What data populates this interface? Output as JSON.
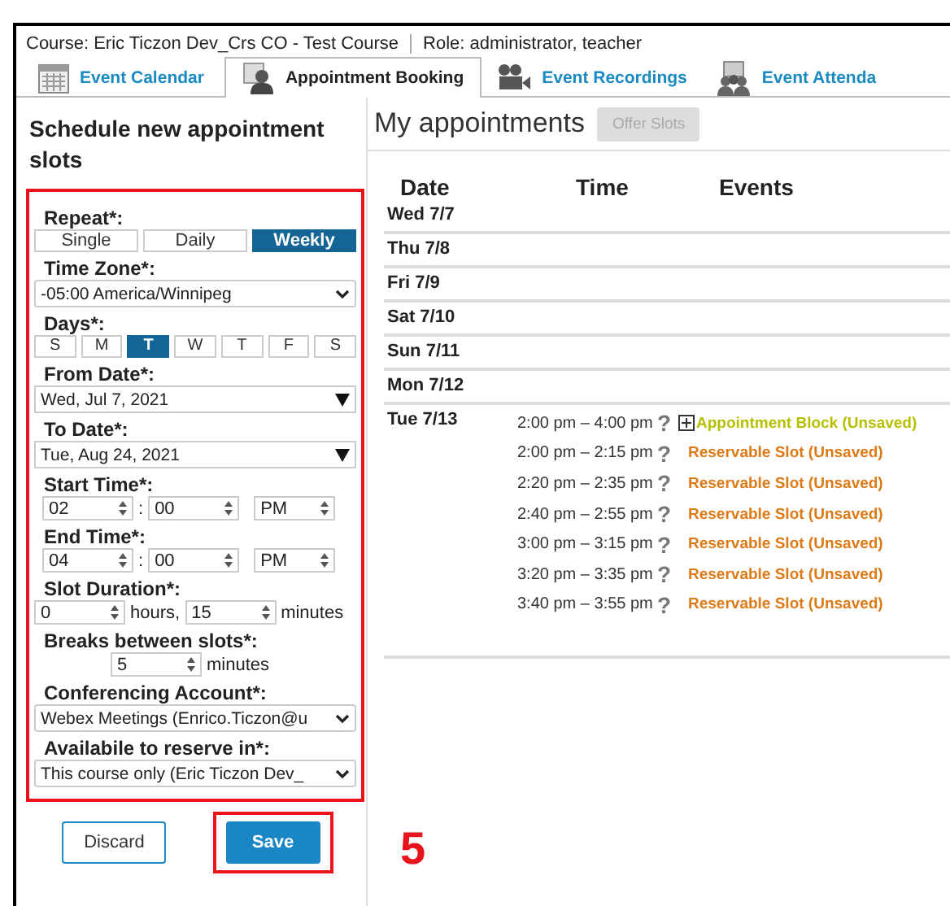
{
  "header": {
    "course": "Course: Eric Ticzon Dev_Crs CO - Test Course",
    "role": "Role: administrator, teacher"
  },
  "tabs": [
    {
      "label": "Event Calendar",
      "selected": false
    },
    {
      "label": "Appointment Booking",
      "selected": true
    },
    {
      "label": "Event Recordings",
      "selected": false
    },
    {
      "label": "Event Attenda",
      "selected": false
    }
  ],
  "form": {
    "title": "Schedule new appointment slots",
    "highlighted": true,
    "fields": [
      {
        "kind": "segmented",
        "label": "Repeat*:",
        "options": [
          {
            "label": "Single",
            "selected": false
          },
          {
            "label": "Daily",
            "selected": false
          },
          {
            "label": "Weekly",
            "selected": true
          }
        ]
      },
      {
        "kind": "select",
        "label": "Time Zone*:",
        "value": "-05:00 America/Winnipeg"
      },
      {
        "kind": "days",
        "label": "Days*:",
        "options": [
          {
            "label": "S",
            "selected": false
          },
          {
            "label": "M",
            "selected": false
          },
          {
            "label": "T",
            "selected": true
          },
          {
            "label": "W",
            "selected": false
          },
          {
            "label": "T",
            "selected": false
          },
          {
            "label": "F",
            "selected": false
          },
          {
            "label": "S",
            "selected": false
          }
        ]
      },
      {
        "kind": "date",
        "label": "From Date*:",
        "value": "Wed, Jul 7, 2021"
      },
      {
        "kind": "date",
        "label": "To Date*:",
        "value": "Tue, Aug 24, 2021"
      },
      {
        "kind": "time",
        "label": "Start Time*:",
        "hour": "02",
        "separator": ":",
        "minute": "00",
        "ampm": "PM"
      },
      {
        "kind": "time",
        "label": "End Time*:",
        "hour": "04",
        "separator": ":",
        "minute": "00",
        "ampm": "PM"
      },
      {
        "kind": "duration",
        "label": "Slot Duration*:",
        "hours": "0",
        "hours_unit": "hours,",
        "minutes": "15",
        "minutes_unit": "minutes"
      },
      {
        "kind": "breaks",
        "label": "Breaks between slots*:",
        "value": "5",
        "unit": "minutes"
      },
      {
        "kind": "select",
        "label": "Conferencing Account*:",
        "value": "Webex Meetings (Enrico.Ticzon@u"
      },
      {
        "kind": "select",
        "label": "Availabile to reserve in*:",
        "value": "This course only (Eric Ticzon Dev_"
      }
    ]
  },
  "buttons": [
    {
      "label": "Discard",
      "kind": "secondary",
      "highlighted": false
    },
    {
      "label": "Save",
      "kind": "primary",
      "highlighted": true
    }
  ],
  "step_number": "5",
  "appointments": {
    "title": "My appointments",
    "offer_button": {
      "label": "Offer Slots",
      "disabled": true
    },
    "columns": [
      "Date",
      "Time",
      "Events"
    ],
    "rows": [
      {
        "date": "Wed 7/7",
        "entries": []
      },
      {
        "date": "Thu 7/8",
        "entries": []
      },
      {
        "date": "Fri 7/9",
        "entries": []
      },
      {
        "date": "Sat 7/10",
        "entries": []
      },
      {
        "date": "Sun 7/11",
        "entries": []
      },
      {
        "date": "Mon 7/12",
        "entries": []
      },
      {
        "date": "Tue 7/13",
        "entries": [
          {
            "time": "2:00 pm – 4:00 pm",
            "help": "?",
            "kind": "block",
            "label": "Appointment Block (Unsaved)"
          },
          {
            "time": "2:00 pm – 2:15 pm",
            "help": "?",
            "kind": "slot",
            "label": "Reservable Slot (Unsaved)"
          },
          {
            "time": "2:20 pm – 2:35 pm",
            "help": "?",
            "kind": "slot",
            "label": "Reservable Slot (Unsaved)"
          },
          {
            "time": "2:40 pm – 2:55 pm",
            "help": "?",
            "kind": "slot",
            "label": "Reservable Slot (Unsaved)"
          },
          {
            "time": "3:00 pm – 3:15 pm",
            "help": "?",
            "kind": "slot",
            "label": "Reservable Slot (Unsaved)"
          },
          {
            "time": "3:20 pm – 3:35 pm",
            "help": "?",
            "kind": "slot",
            "label": "Reservable Slot (Unsaved)"
          },
          {
            "time": "3:40 pm – 3:55 pm",
            "help": "?",
            "kind": "slot",
            "label": "Reservable Slot (Unsaved)"
          }
        ]
      }
    ]
  }
}
